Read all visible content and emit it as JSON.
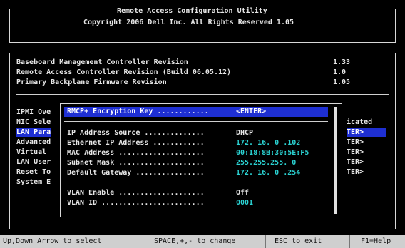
{
  "header": {
    "title": "Remote Access Configuration Utility",
    "copyright": "Copyright 2006 Dell Inc. All Rights Reserved 1.05"
  },
  "revisions": [
    {
      "label": "Baseboard Management Controller Revision",
      "value": "1.33"
    },
    {
      "label": "Remote Access Controller Revision (Build 06.05.12)",
      "value": "1.0"
    },
    {
      "label": "Primary Backplane Firmware Revision",
      "value": "1.05"
    }
  ],
  "menu": {
    "left_items": [
      "IPMI Ove",
      "NIC Sele",
      "LAN Para",
      "Advanced",
      "Virtual ",
      "LAN User",
      "Reset To",
      "System E"
    ],
    "right_items": [
      "icated",
      "TER>",
      "TER>",
      "TER>",
      "TER>",
      "TER>"
    ]
  },
  "popup": {
    "title_row": {
      "label": "RMCP+ Encryption Key ............",
      "value": "<ENTER>"
    },
    "fields": [
      {
        "label": "IP Address Source ..............",
        "value": "DHCP"
      },
      {
        "label": "Ethernet IP Address ............",
        "value": "172. 16. 0 .102"
      },
      {
        "label": "MAC Address ....................",
        "value": "00:18:8B:30:5E:F5"
      },
      {
        "label": "Subnet Mask ....................",
        "value": "255.255.255. 0"
      },
      {
        "label": "Default Gateway ................",
        "value": "172. 16. 0 .254"
      }
    ],
    "vlan": [
      {
        "label": "VLAN Enable ....................",
        "value": "Off"
      },
      {
        "label": "VLAN ID ........................",
        "value": "0001"
      }
    ]
  },
  "statusbar": {
    "nav": "Up,Down Arrow to select",
    "change": "SPACE,+,- to change",
    "exit": "ESC to exit",
    "help": "F1=Help"
  }
}
